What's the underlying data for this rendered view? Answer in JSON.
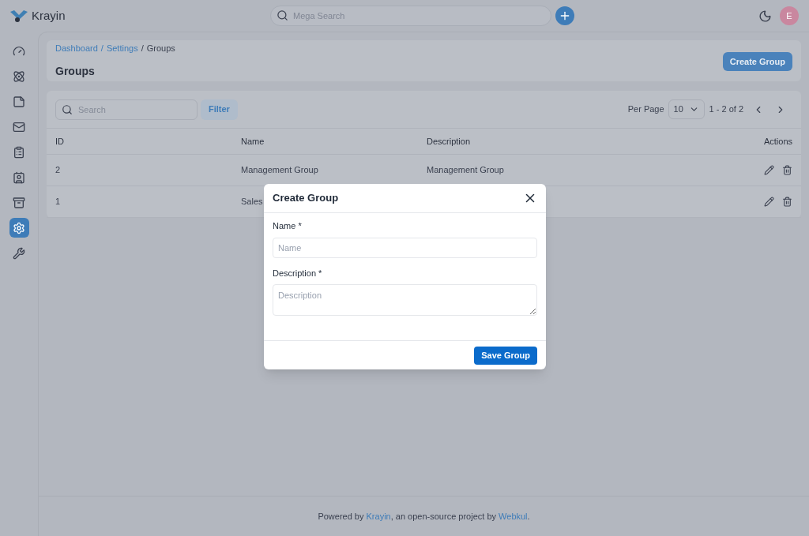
{
  "header": {
    "logo": "Krayin",
    "search": {
      "placeholder": "Mega Search"
    },
    "avatar": "E"
  },
  "sidebar": {
    "items": [
      {
        "selected": false
      },
      {
        "selected": false
      },
      {
        "selected": false
      },
      {
        "selected": false
      },
      {
        "selected": false
      },
      {
        "selected": false
      },
      {
        "selected": false
      },
      {
        "selected": true
      },
      {
        "selected": false
      }
    ]
  },
  "breadcrumbs": [
    {
      "text": "Dashboard",
      "kind": "link"
    },
    {
      "text": "/",
      "kind": "link"
    },
    {
      "text": "Settings",
      "kind": "link"
    },
    {
      "text": "/",
      "kind": "text"
    },
    {
      "text": "Groups",
      "kind": "text"
    }
  ],
  "page_title": "Groups",
  "create_button": "Create Group",
  "toolbar": {
    "search": {
      "placeholder": "Search"
    },
    "filter": "Filter",
    "per_page_label": "Per Page",
    "per_page": "10",
    "range": "1 - 2 of 2"
  },
  "table": {
    "columns": [
      "ID",
      "Name",
      "Description",
      "Actions"
    ],
    "rows": [
      {
        "id": "2",
        "name": "Management Group",
        "description": "Management Group"
      },
      {
        "id": "1",
        "name": "Sales"
      }
    ]
  },
  "modal": {
    "title": "Create Group",
    "fields": [
      {
        "label": "Name *",
        "placeholder": "Name",
        "kind": "input"
      },
      {
        "label": "Description *",
        "placeholder": "Description",
        "kind": "textarea"
      }
    ],
    "save": "Save Group"
  },
  "footer": {
    "parts": [
      {
        "text": "Powered by ",
        "kind": "text"
      },
      {
        "text": "Krayin",
        "kind": "link"
      },
      {
        "text": ", an open-source project by ",
        "kind": "text"
      },
      {
        "text": "Webkul",
        "kind": "link"
      },
      {
        "text": ".",
        "kind": "text"
      }
    ]
  }
}
